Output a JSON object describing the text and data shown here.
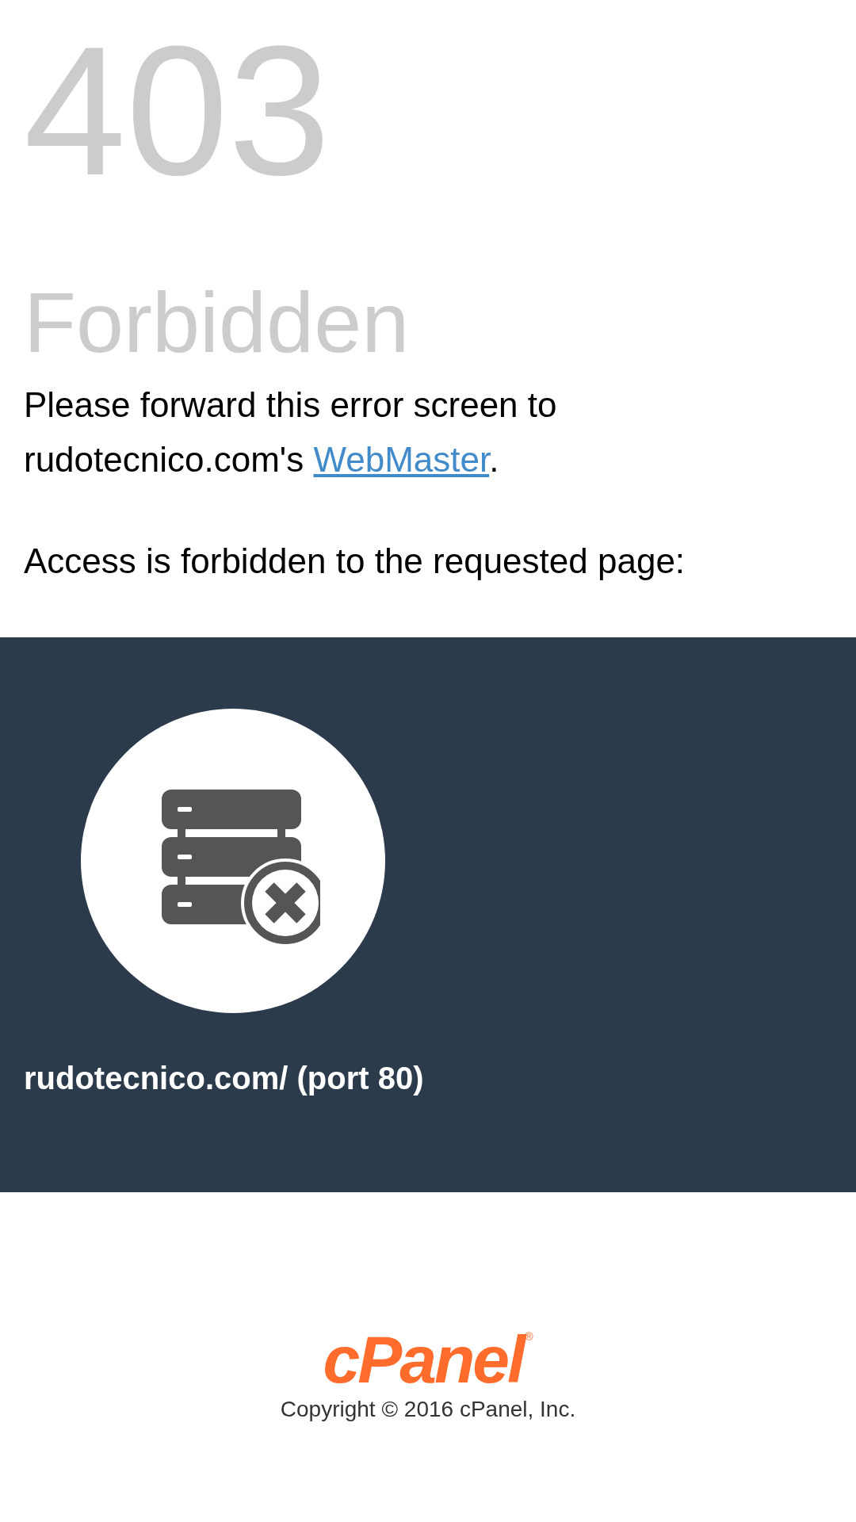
{
  "error_code": "403",
  "heading": "Forbidden",
  "message": {
    "text": "Please forward this error screen to rudotecnico.com's ",
    "link": "WebMaster",
    "after": "."
  },
  "detail": "Access is forbidden to the requested page:",
  "banner": {
    "url": "rudotecnico.com/ (port 80)"
  },
  "footer": {
    "logo": "cPanel",
    "logo_mark": "®",
    "copyright": "Copyright © 2016 cPanel, Inc."
  }
}
